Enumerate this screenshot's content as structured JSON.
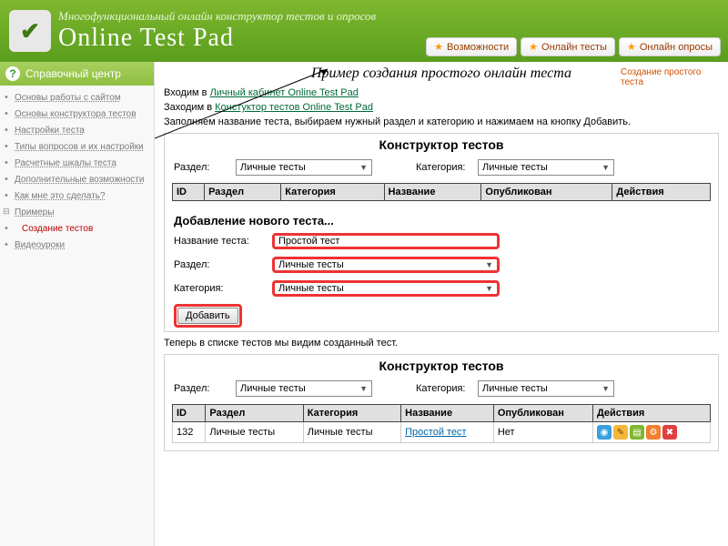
{
  "header": {
    "tagline": "Многофункциональный онлайн конструктор тестов и опросов",
    "brand": "Online Test Pad",
    "tabs": {
      "features": "Возможности",
      "tests": "Онлайн тесты",
      "polls": "Онлайн опросы"
    }
  },
  "sidebar": {
    "title": "Справочный центр",
    "items": {
      "basics": "Основы работы с сайтом",
      "constructor_basics": "Основы конструктора тестов",
      "settings": "Настройки теста",
      "qtypes": "Типы вопросов и их настройки",
      "scales": "Расчетные шкалы теста",
      "extra": "Дополнительные возможности",
      "howto": "Как мне это сделать?",
      "examples": "Примеры",
      "create_tests": "Создание тестов",
      "videos": "Видеоуроки"
    }
  },
  "right_note": "Создание простого теста",
  "page_title": "Пример создания простого онлайн теста",
  "intro": {
    "line1_a": "Входим в ",
    "line1_link": "Личный кабинет Online Test Pad",
    "line2_a": "Заходим в ",
    "line2_link": "Констуктор тестов Online Test Pad",
    "line3": "Заполняем название теста, выбираем нужный раздел и категорию и нажимаем на кнопку Добавить."
  },
  "panel1": {
    "title": "Конструктор тестов",
    "section_label": "Раздел:",
    "section_value": "Личные тесты",
    "category_label": "Категория:",
    "category_value": "Личные тесты",
    "cols": {
      "id": "ID",
      "section": "Раздел",
      "category": "Категория",
      "name": "Название",
      "published": "Опубликован",
      "actions": "Действия"
    }
  },
  "newtest": {
    "heading": "Добавление нового теста...",
    "name_label": "Название теста:",
    "name_value": "Простой тест",
    "section_label": "Раздел:",
    "section_value": "Личные тесты",
    "category_label": "Категория:",
    "category_value": "Личные тесты",
    "add_button": "Добавить"
  },
  "after_text": "Теперь в списке тестов мы видим созданный тест.",
  "panel2": {
    "title": "Конструктор тестов",
    "section_label": "Раздел:",
    "section_value": "Личные тесты",
    "category_label": "Категория:",
    "category_value": "Личные тесты",
    "cols": {
      "id": "ID",
      "section": "Раздел",
      "category": "Категория",
      "name": "Название",
      "published": "Опубликован",
      "actions": "Действия"
    },
    "row": {
      "id": "132",
      "section": "Личные тесты",
      "category": "Личные тесты",
      "name": "Простой тест",
      "published": "Нет"
    }
  }
}
